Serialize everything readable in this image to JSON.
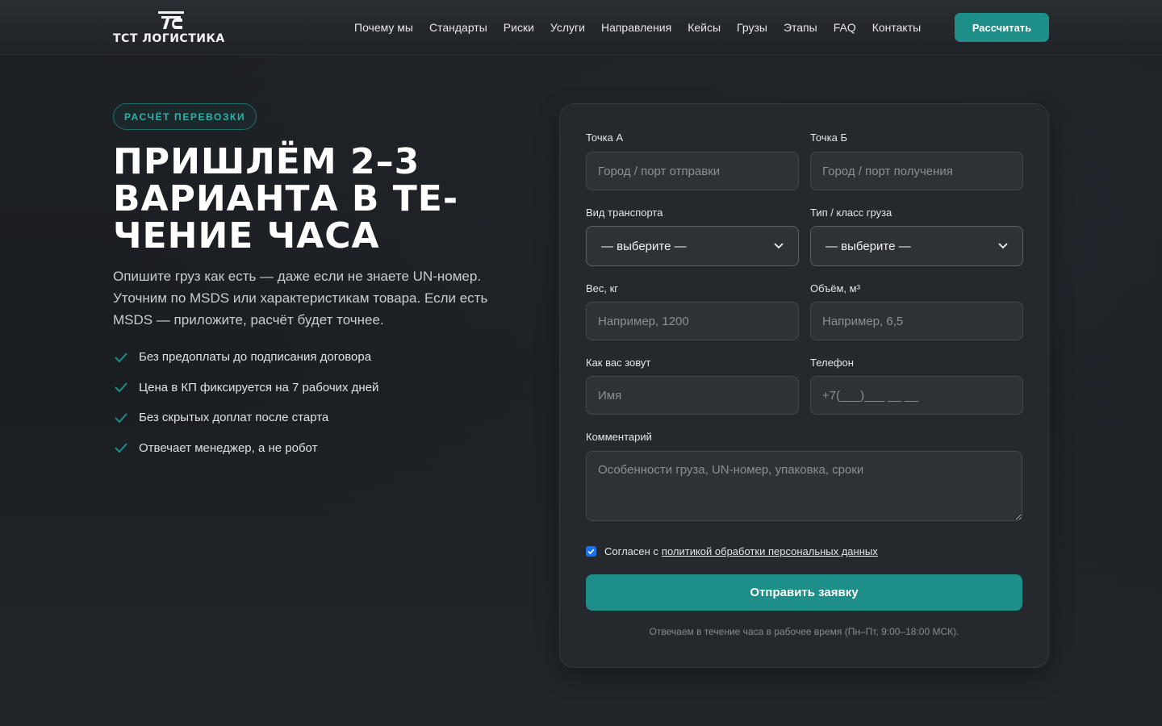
{
  "header": {
    "logo_text": "ТСТ ЛОГИСТИКА",
    "nav": [
      "Почему мы",
      "Стандарты",
      "Риски",
      "Услуги",
      "Направления",
      "Кейсы",
      "Грузы",
      "Этапы",
      "FAQ",
      "Контакты"
    ],
    "cta_label": "Рассчитать"
  },
  "hero": {
    "pill": "РАСЧЁТ ПЕРЕВОЗКИ",
    "title": "ПРИШЛЁМ 2–3 ВАРИАНТА В ТЕ-ЧЕНИЕ ЧАСА",
    "lead": "Опишите груз как есть — даже если не знаете UN-номер. Уточним по MSDS или характеристикам товара. Если есть MSDS — приложите, расчёт будет точнее.",
    "benefits": [
      "Без предоплаты до подписания договора",
      "Цена в КП фиксируется на 7 рабочих дней",
      "Без скрытых доплат после старта",
      "Отвечает менеджер, а не робот"
    ]
  },
  "form": {
    "point_a": {
      "label": "Точка А",
      "placeholder": "Город / порт отправки",
      "value": ""
    },
    "point_b": {
      "label": "Точка Б",
      "placeholder": "Город / порт получения",
      "value": ""
    },
    "transport": {
      "label": "Вид транспорта",
      "selected": "— выберите —"
    },
    "cargo_class": {
      "label": "Тип / класс груза",
      "selected": "— выберите —"
    },
    "weight": {
      "label": "Вес, кг",
      "placeholder": "Например, 1200",
      "value": ""
    },
    "volume": {
      "label": "Объём, м³",
      "placeholder": "Например, 6,5",
      "value": ""
    },
    "name": {
      "label": "Как вас зовут",
      "placeholder": "Имя",
      "value": ""
    },
    "phone": {
      "label": "Телефон",
      "placeholder": "+7(___)___ __ __",
      "value": ""
    },
    "comment": {
      "label": "Комментарий",
      "placeholder": "Особенности груза, UN-номер, упаковка, сроки",
      "value": ""
    },
    "consent_prefix": "Согласен с",
    "consent_link": "политикой обработки персональных данных",
    "consent_checked": true,
    "submit_label": "Отправить заявку",
    "note": "Отвечаем в течение часа в рабочее время (Пн–Пт, 9:00–18:00 МСК)."
  },
  "colors": {
    "accent": "#1e8f88",
    "accent_text": "#2ab3a8",
    "background": "#1b1e22",
    "card": "#25292d"
  },
  "icons": {
    "logo": "tst-logo-mark",
    "benefit": "check-icon",
    "select": "chevron-down-icon"
  }
}
